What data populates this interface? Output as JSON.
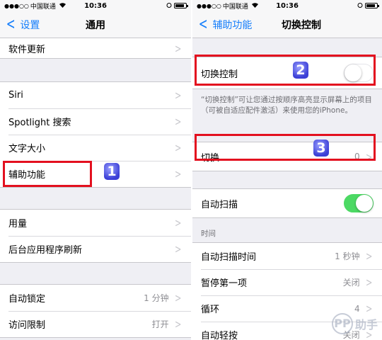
{
  "status_bar": {
    "signal": "●●●○○",
    "carrier": "中国联通",
    "time": "10:36"
  },
  "left": {
    "nav": {
      "back_label": "设置",
      "title": "通用"
    },
    "group1": [
      {
        "label": "软件更新"
      }
    ],
    "group2": [
      {
        "label": "Siri"
      },
      {
        "label": "Spotlight 搜索"
      },
      {
        "label": "文字大小"
      },
      {
        "label": "辅助功能"
      }
    ],
    "group3": [
      {
        "label": "用量"
      },
      {
        "label": "后台应用程序刷新"
      }
    ],
    "group4": [
      {
        "label": "自动锁定",
        "value": "1 分钟"
      },
      {
        "label": "访问限制",
        "value": "打开"
      }
    ]
  },
  "right": {
    "nav": {
      "back_label": "辅助功能",
      "title": "切换控制"
    },
    "switch_control": {
      "label": "切换控制",
      "on": false
    },
    "note": "“切换控制”可让您通过按顺序高亮显示屏幕上的项目（可被自适应配件激活）来使用您的iPhone。",
    "switches": {
      "label": "切换",
      "value": "0"
    },
    "auto_scan": {
      "label": "自动扫描",
      "on": true
    },
    "time_header": "时间",
    "time_rows": [
      {
        "label": "自动扫描时间",
        "value": "1 秒钟"
      },
      {
        "label": "暂停第一项",
        "value": "关闭"
      },
      {
        "label": "循环",
        "value": "4"
      },
      {
        "label": "自动轻按",
        "value": "关闭"
      }
    ]
  },
  "annotations": {
    "badge1": "1",
    "badge2": "2",
    "badge3": "3"
  },
  "watermark": {
    "logo": "PP",
    "text": "助手"
  },
  "colors": {
    "accent": "#157efb",
    "toggle_on": "#4cd964",
    "highlight": "#e3101f"
  }
}
